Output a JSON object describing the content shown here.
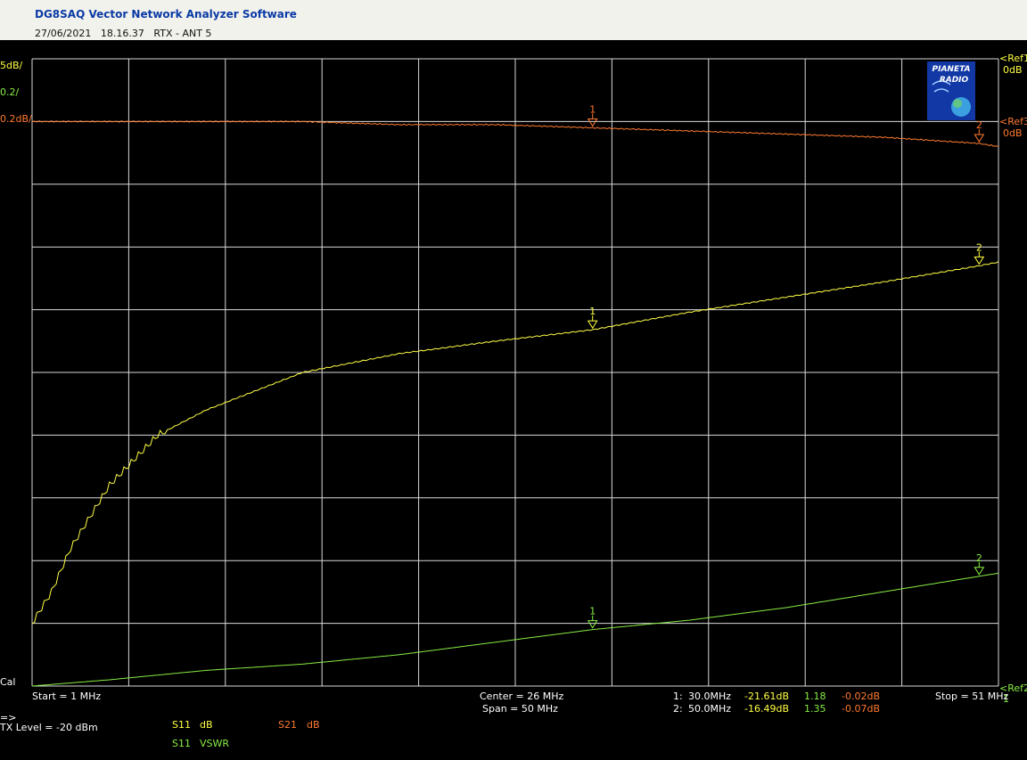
{
  "window": {
    "title": "DG8SAQ Vector Network Analyzer Software",
    "date": "27/06/2021",
    "time": "18.16.37",
    "label": "RTX - ANT 5"
  },
  "colors": {
    "background": "#000000",
    "grid": "#d9d9d9",
    "s21_db": "#ff7a2e",
    "s11_db": "#ffff44",
    "s11_vswr": "#88ee44",
    "text": "#ffffff"
  },
  "left_labels": {
    "top_scale": "5dB/",
    "second_scale": "0.2/",
    "third_scale": "0.2dB/",
    "cal": "Cal"
  },
  "right_refs": {
    "ref1": "<Ref1",
    "ref1_val": "0dB",
    "ref3": "<Ref3",
    "ref3_val": "0dB",
    "ref2": "<Ref2",
    "ref2_val": "1"
  },
  "logo_text": [
    "PIANETA",
    "RADIO"
  ],
  "freq": {
    "start": "Start = 1 MHz",
    "center": "Center = 26 MHz",
    "span": "Span = 50 MHz",
    "stop": "Stop = 51 MHz"
  },
  "markers_table": [
    {
      "id": "1:",
      "freq": "30.0MHz",
      "s11_db": "-21.61dB",
      "vswr": "1.18",
      "s21_db": "-0.02dB"
    },
    {
      "id": "2:",
      "freq": "50.0MHz",
      "s11_db": "-16.49dB",
      "vswr": "1.35",
      "s21_db": "-0.07dB"
    }
  ],
  "footer": {
    "arrow": "=>",
    "tx_level": "TX Level = -20 dBm",
    "legend": [
      {
        "param": "S11",
        "unit": "dB"
      },
      {
        "param": "S21",
        "unit": "dB"
      },
      {
        "param": "S11",
        "unit": "VSWR"
      }
    ]
  },
  "chart_data": {
    "type": "line",
    "x_range": [
      1,
      51
    ],
    "x_unit": "MHz",
    "series": [
      {
        "name": "S21",
        "unit": "dB",
        "x": [
          1,
          5,
          10,
          15,
          20,
          25,
          30,
          35,
          40,
          45,
          50,
          51
        ],
        "values": [
          0,
          0,
          0,
          0,
          -0.01,
          -0.01,
          -0.02,
          -0.03,
          -0.04,
          -0.05,
          -0.07,
          -0.08
        ]
      },
      {
        "name": "S11",
        "unit": "dB",
        "x": [
          1,
          2,
          3,
          5,
          7.5,
          10,
          12.5,
          15,
          20,
          25,
          30,
          35,
          40,
          45,
          50,
          51
        ],
        "values": [
          -45,
          -42.5,
          -39,
          -34,
          -30,
          -28,
          -26.5,
          -25,
          -23.5,
          -22.5,
          -21.6,
          -20.2,
          -19,
          -17.8,
          -16.5,
          -16.2
        ]
      },
      {
        "name": "S11",
        "unit": "VSWR",
        "x": [
          1,
          5,
          10,
          15,
          20,
          25,
          30,
          35,
          40,
          45,
          50,
          51
        ],
        "values": [
          1.0,
          1.02,
          1.05,
          1.07,
          1.1,
          1.14,
          1.18,
          1.21,
          1.25,
          1.3,
          1.35,
          1.36
        ]
      }
    ],
    "markers": [
      {
        "label": "1",
        "x": 30
      },
      {
        "label": "2",
        "x": 50
      }
    ]
  }
}
